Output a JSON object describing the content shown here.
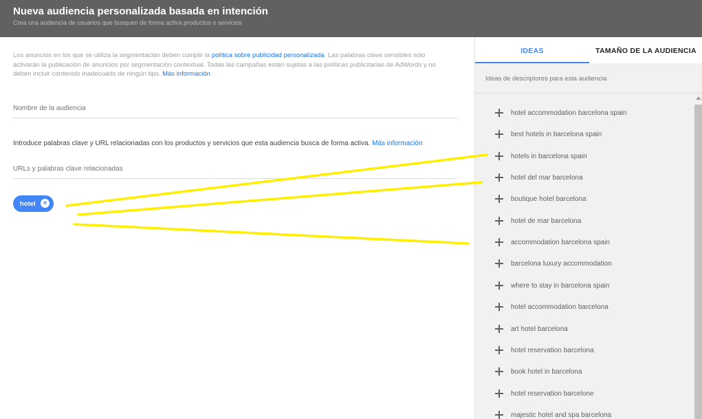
{
  "header": {
    "title": "Nueva audiencia personalizada basada en intención",
    "subtitle": "Crea una audiencia de usuarios que busquen de forma activa productos o servicios"
  },
  "left": {
    "policy_text_1": "Los anuncios en los que se utiliza la segmentación deben cumplir la ",
    "policy_link": "política sobre publicidad personalizada",
    "policy_text_2": ". Las palabras clave sensibles solo activarán la publicación de anuncios por segmentación contextual. Todas las campañas están sujetas a las políticas publicitarias de AdWords y no deben incluir contenido inadecuado de ningún tipo. ",
    "policy_more": "Más información",
    "audience_name_placeholder": "Nombre de la audiencia",
    "intro_text": "Introduce palabras clave y URL relacionadas con los productos y servicios que esta audiencia busca de forma activa. ",
    "intro_more": "Más información",
    "urls_placeholder": "URLs y palabras clave relacionadas",
    "chip_label": "hotel",
    "chip_close_icon": "close-circle-icon"
  },
  "right": {
    "tabs": [
      {
        "label": "IDEAS",
        "active": true
      },
      {
        "label": "TAMAÑO DE LA AUDIENCIA",
        "active": false
      }
    ],
    "caption": "Ideas de descriptores para esta audiencia",
    "add_icon": "plus-icon",
    "ideas": [
      "hotel accommodation barcelona spain",
      "best hotels in barcelona spain",
      "hotels in barcelona spain",
      "hotel del mar barcelona",
      "boutique hotel barcelona",
      "hotel de mar barcelona",
      "accommodation barcelona spain",
      "barcelona luxury accommodation",
      "where to stay in barcelona spain",
      "hotel accommodation barcelona",
      "art hotel barcelona",
      "hotel reservation barcelona",
      "book hotel in barcelona",
      "hotel reservation barcelone",
      "majestic hotel and spa barcelona"
    ]
  },
  "colors": {
    "header_bg": "#616161",
    "accent": "#4285f4",
    "annotation": "#ffee00"
  }
}
